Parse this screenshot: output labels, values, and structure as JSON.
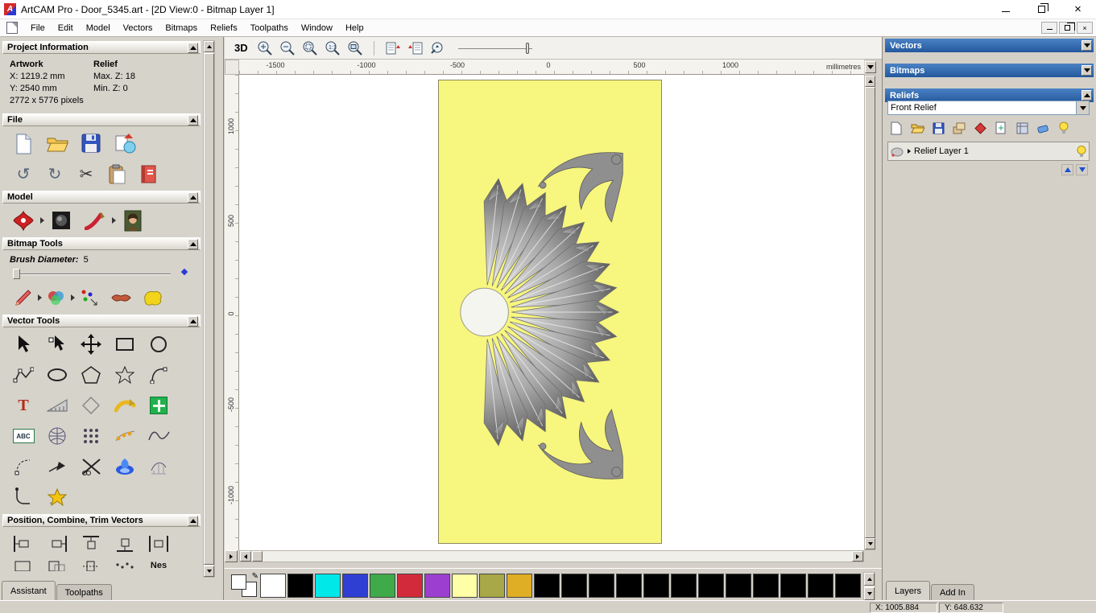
{
  "window": {
    "title": "ArtCAM Pro - Door_5345.art - [2D View:0 - Bitmap Layer 1]"
  },
  "menu": {
    "items": [
      "File",
      "Edit",
      "Model",
      "Vectors",
      "Bitmaps",
      "Reliefs",
      "Toolpaths",
      "Window",
      "Help"
    ]
  },
  "assistant": {
    "project_information": {
      "title": "Project Information",
      "col_artwork": "Artwork",
      "col_relief": "Relief",
      "artwork_x": "X: 1219.2 mm",
      "artwork_y": "Y: 2540 mm",
      "artwork_pixels": "2772 x 5776 pixels",
      "relief_max_z": "Max. Z: 18",
      "relief_min_z": "Min. Z: 0"
    },
    "sections": {
      "file": "File",
      "model": "Model",
      "bitmap_tools": "Bitmap Tools",
      "vector_tools": "Vector Tools",
      "position": "Position, Combine, Trim Vectors"
    },
    "brush_diameter_label": "Brush Diameter:",
    "brush_diameter_value": "5",
    "nes_label": "Nes",
    "tabs": [
      "Assistant",
      "Toolpaths"
    ]
  },
  "view": {
    "toolbar": {
      "view_3d": "3D"
    },
    "ruler_units": "millimetres",
    "ruler_h_ticks": [
      "-1500",
      "-1000",
      "-500",
      "0",
      "500",
      "1000"
    ],
    "ruler_v_ticks": [
      "1000",
      "500",
      "0",
      "-500",
      "-1000"
    ]
  },
  "right_panel": {
    "vectors_title": "Vectors",
    "bitmaps_title": "Bitmaps",
    "reliefs_title": "Reliefs",
    "relief_combo_value": "Front Relief",
    "relief_layer_name": "Relief Layer 1",
    "tabs": [
      "Layers",
      "Add In"
    ]
  },
  "status": {
    "x": "X: 1005.884",
    "y": "Y: 648.632"
  },
  "palette": {
    "colors": [
      "#ffffff",
      "#000000",
      "#00e8e8",
      "#2f3fd3",
      "#3eaa4a",
      "#d22a3a",
      "#9c3fd0",
      "#ffffa8",
      "#a8a848",
      "#dfae25",
      "#000000",
      "#000000",
      "#000000",
      "#000000",
      "#000000",
      "#000000",
      "#000000",
      "#000000",
      "#000000",
      "#000000",
      "#000000",
      "#000000"
    ]
  },
  "icons": {
    "cut": "✂",
    "undo": "↺",
    "redo": "↻",
    "close": "×",
    "text_t": "T",
    "abc": "ABC",
    "pencil": "✎"
  }
}
